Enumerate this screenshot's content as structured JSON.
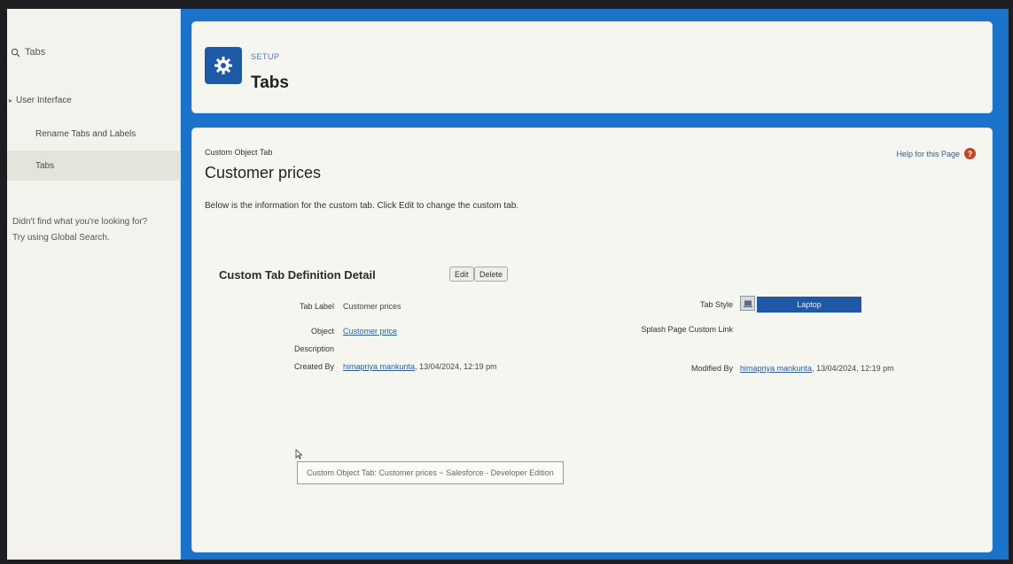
{
  "sidebar": {
    "search_value": "Tabs",
    "tree_parent": "User Interface",
    "items": [
      {
        "label": "Rename Tabs and Labels"
      },
      {
        "label": "Tabs"
      }
    ],
    "help_line1": "Didn't find what you're looking for?",
    "help_line2": "Try using Global Search."
  },
  "header": {
    "eyebrow": "SETUP",
    "title": "Tabs"
  },
  "content": {
    "eyebrow": "Custom Object Tab",
    "title": "Customer prices",
    "help_link": "Help for this Page",
    "description": "Below is the information for the custom tab. Click Edit to change the custom tab.",
    "section_title": "Custom Tab Definition Detail",
    "edit_label": "Edit",
    "delete_label": "Delete",
    "fields": {
      "tab_label_label": "Tab Label",
      "tab_label_value": "Customer prices",
      "object_label": "Object",
      "object_value": "Customer price",
      "description_label": "Description",
      "created_by_label": "Created By",
      "created_by_user": "himapriya mankunta",
      "created_by_date": "13/04/2024, 12:19 pm",
      "tab_style_label": "Tab Style",
      "tab_style_value": "Laptop",
      "splash_label": "Splash Page Custom Link",
      "modified_by_label": "Modified By",
      "modified_by_user": "himapriya mankunta",
      "modified_by_date": "13/04/2024, 12:19 pm"
    },
    "tooltip": "Custom Object Tab: Customer prices ~ Salesforce - Developer Edition"
  },
  "colors": {
    "brand_blue": "#1a73c9",
    "icon_blue": "#1e5aa8",
    "help_orange": "#c8431f"
  },
  "icons": [
    "search-icon",
    "chevron-right-icon",
    "gear-icon",
    "help-icon",
    "laptop-icon",
    "cursor-icon"
  ]
}
